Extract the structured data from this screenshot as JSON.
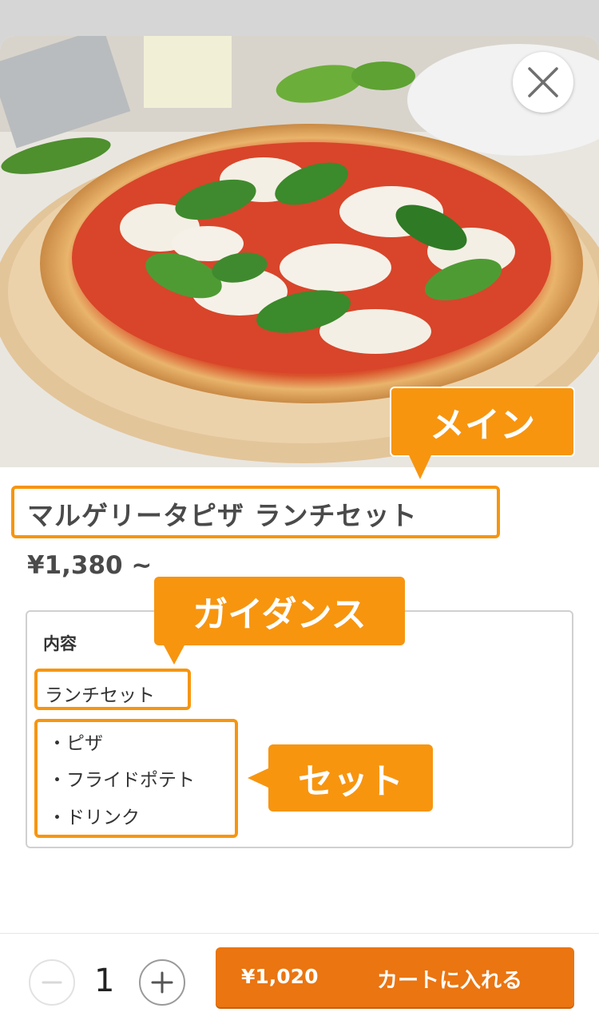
{
  "product": {
    "image_alt": "pizza-photo",
    "title": "マルゲリータピザ ランチセット",
    "price": "¥1,380 ~"
  },
  "contents": {
    "heading": "内容",
    "set_name": "ランチセット",
    "items": [
      "・ピザ",
      "・フライドポテト",
      "・ドリンク"
    ]
  },
  "annotations": {
    "main": "メイン",
    "guidance": "ガイダンス",
    "set": "セット"
  },
  "cart": {
    "quantity": "1",
    "price": "¥1,020",
    "label": "カートに入れる"
  },
  "colors": {
    "accent": "#f7950f",
    "cart_button": "#ea7511",
    "text": "#4a4a4a"
  },
  "icons": {
    "close": "close-icon",
    "minus": "minus-icon",
    "plus": "plus-icon"
  }
}
